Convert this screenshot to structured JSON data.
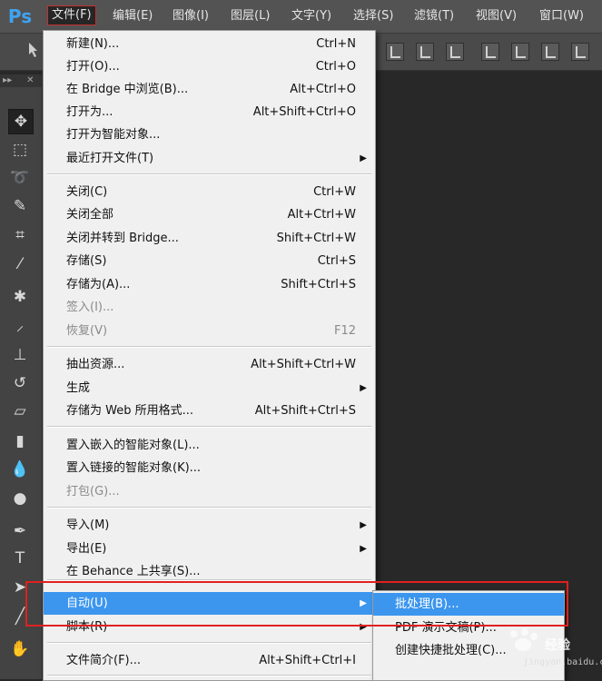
{
  "app": {
    "logo": "Ps"
  },
  "menubar": {
    "items": [
      {
        "label": "文件(F)"
      },
      {
        "label": "编辑(E)"
      },
      {
        "label": "图像(I)"
      },
      {
        "label": "图层(L)"
      },
      {
        "label": "文字(Y)"
      },
      {
        "label": "选择(S)"
      },
      {
        "label": "滤镜(T)"
      },
      {
        "label": "视图(V)"
      },
      {
        "label": "窗口(W)"
      }
    ]
  },
  "file_menu": {
    "items": [
      {
        "label": "新建(N)...",
        "shortcut": "Ctrl+N"
      },
      {
        "label": "打开(O)...",
        "shortcut": "Ctrl+O"
      },
      {
        "label": "在 Bridge 中浏览(B)...",
        "shortcut": "Alt+Ctrl+O"
      },
      {
        "label": "打开为...",
        "shortcut": "Alt+Shift+Ctrl+O"
      },
      {
        "label": "打开为智能对象..."
      },
      {
        "label": "最近打开文件(T)",
        "submenu": true
      },
      {
        "label": "关闭(C)",
        "shortcut": "Ctrl+W"
      },
      {
        "label": "关闭全部",
        "shortcut": "Alt+Ctrl+W"
      },
      {
        "label": "关闭并转到 Bridge...",
        "shortcut": "Shift+Ctrl+W"
      },
      {
        "label": "存储(S)",
        "shortcut": "Ctrl+S"
      },
      {
        "label": "存储为(A)...",
        "shortcut": "Shift+Ctrl+S"
      },
      {
        "label": "签入(I)...",
        "disabled": true
      },
      {
        "label": "恢复(V)",
        "shortcut": "F12",
        "disabled": true
      },
      {
        "label": "抽出资源...",
        "shortcut": "Alt+Shift+Ctrl+W"
      },
      {
        "label": "生成",
        "submenu": true
      },
      {
        "label": "存储为 Web 所用格式...",
        "shortcut": "Alt+Shift+Ctrl+S"
      },
      {
        "label": "置入嵌入的智能对象(L)..."
      },
      {
        "label": "置入链接的智能对象(K)..."
      },
      {
        "label": "打包(G)...",
        "disabled": true
      },
      {
        "label": "导入(M)",
        "submenu": true
      },
      {
        "label": "导出(E)",
        "submenu": true
      },
      {
        "label": "在 Behance 上共享(S)..."
      },
      {
        "label": "自动(U)",
        "submenu": true,
        "highlighted": true
      },
      {
        "label": "脚本(R)",
        "submenu": true
      },
      {
        "label": "文件简介(F)...",
        "shortcut": "Alt+Shift+Ctrl+I"
      }
    ]
  },
  "auto_submenu": {
    "items": [
      {
        "label": "批处理(B)...",
        "highlighted": true
      },
      {
        "label": "PDF 演示文稿(P)..."
      },
      {
        "label": "创建快捷批处理(C)..."
      }
    ]
  },
  "watermark": {
    "text": "经验",
    "url": "jingyan.baidu.com"
  },
  "colors": {
    "highlight": "#3c96ee",
    "annotation_box": "#e02020",
    "logo": "#3fa3f3"
  }
}
